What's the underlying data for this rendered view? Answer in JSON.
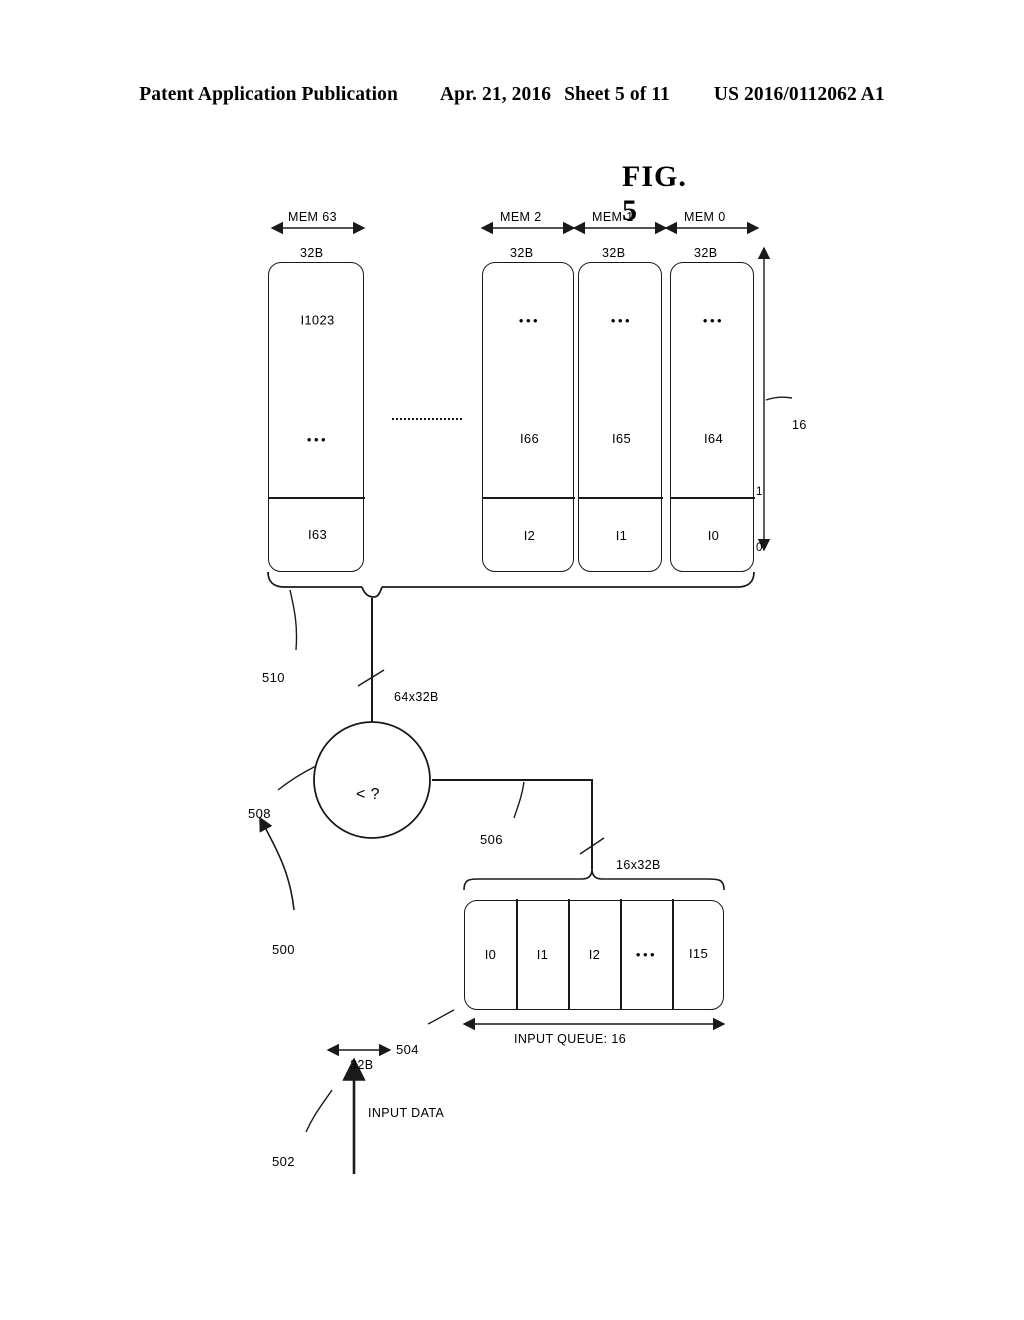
{
  "header": {
    "left": "Patent Application Publication",
    "date": "Apr. 21, 2016",
    "sheet": "Sheet 5 of 11",
    "patent_number": "US 2016/0112062 A1"
  },
  "figure": {
    "caption": "FIG. 5",
    "diagram_ref": "500",
    "input_data_label": "INPUT DATA",
    "input_data_ref": "502",
    "input_queue_ref": "504",
    "input_queue_title": "INPUT QUEUE: 16",
    "input_queue_width_label": "32B",
    "input_queue_bus_label": "16x32B",
    "queue_cells": [
      "I0",
      "I1",
      "I2",
      "•••",
      "I15"
    ],
    "link_506_ref": "506",
    "comparator_ref": "508",
    "comparator_symbol": "< ?",
    "comparator_bus_label": "64x32B",
    "memory_bank_ref": "510",
    "memory_count_label": "16",
    "memory_column_labels": [
      "0",
      "1"
    ],
    "memories": [
      {
        "name": "MEM 0",
        "height_label": "32B",
        "cells": [
          "I0",
          "I64",
          "•••"
        ]
      },
      {
        "name": "MEM 1",
        "height_label": "32B",
        "cells": [
          "I1",
          "I65",
          "•••"
        ]
      },
      {
        "name": "MEM 2",
        "height_label": "32B",
        "cells": [
          "I2",
          "I66",
          "•••"
        ]
      },
      {
        "name": "MEM 63",
        "height_label": "32B",
        "cells": [
          "I63",
          "•••",
          "I1023"
        ]
      }
    ],
    "vertical_ellipsis": "⋮"
  },
  "colors": {
    "ink": "#1a1a1a",
    "page": "#ffffff"
  }
}
